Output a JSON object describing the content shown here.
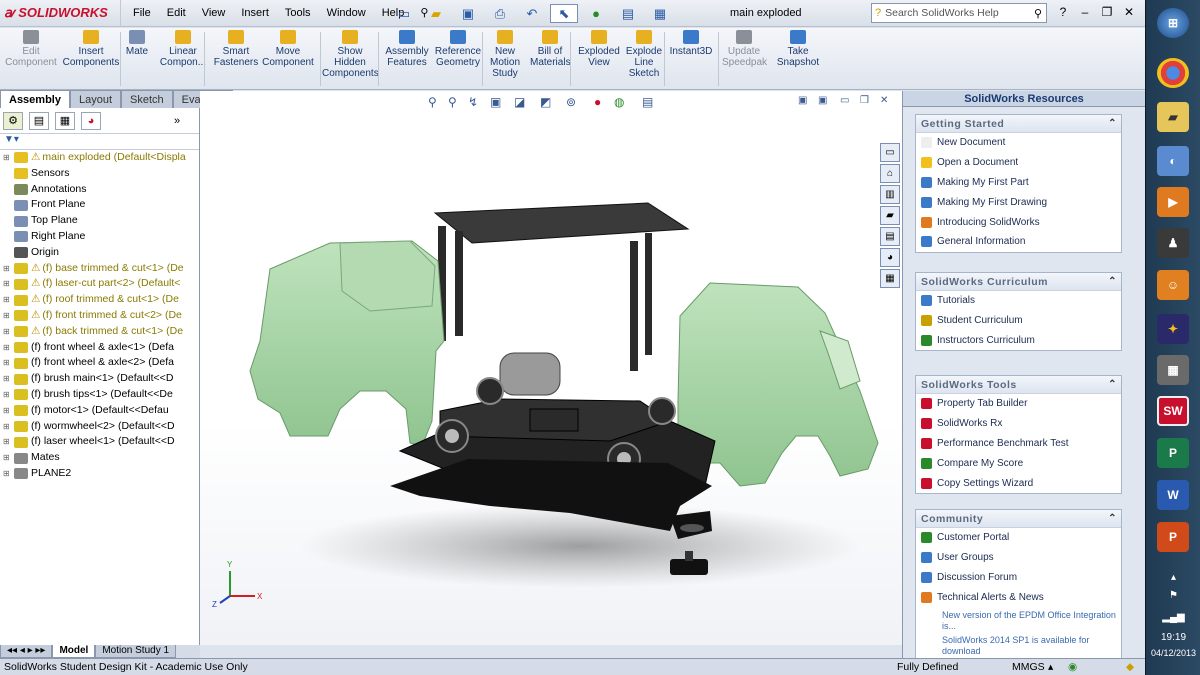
{
  "app": {
    "brand": "SOLIDWORKS",
    "doc_title": "main exploded"
  },
  "menu": [
    "File",
    "Edit",
    "View",
    "Insert",
    "Tools",
    "Window",
    "Help"
  ],
  "search": {
    "placeholder": "Search SolidWorks Help"
  },
  "commands": [
    {
      "label": "Edit Component",
      "disabled": true
    },
    {
      "label": "Insert Components"
    },
    {
      "label": "Mate"
    },
    {
      "label": "Linear Compon..."
    },
    {
      "label": "Smart Fasteners"
    },
    {
      "label": "Move Component"
    },
    {
      "label": "Show Hidden Components"
    },
    {
      "label": "Assembly Features"
    },
    {
      "label": "Reference Geometry"
    },
    {
      "label": "New Motion Study"
    },
    {
      "label": "Bill of Materials"
    },
    {
      "label": "Exploded View"
    },
    {
      "label": "Explode Line Sketch"
    },
    {
      "label": "Instant3D"
    },
    {
      "label": "Update Speedpak",
      "disabled": true
    },
    {
      "label": "Take Snapshot"
    }
  ],
  "tabs": [
    "Assembly",
    "Layout",
    "Sketch",
    "Evaluate"
  ],
  "tree": [
    {
      "label": "main exploded  (Default<Displa",
      "level": 0,
      "warn": true,
      "olive": true
    },
    {
      "label": "Sensors",
      "level": 1
    },
    {
      "label": "Annotations",
      "level": 1
    },
    {
      "label": "Front Plane",
      "level": 1
    },
    {
      "label": "Top Plane",
      "level": 1
    },
    {
      "label": "Right Plane",
      "level": 1
    },
    {
      "label": "Origin",
      "level": 1
    },
    {
      "label": "(f) base trimmed & cut<1> (De",
      "level": 1,
      "warn": true,
      "olive": true
    },
    {
      "label": "(f) laser-cut part<2> (Default<",
      "level": 1,
      "warn": true,
      "olive": true
    },
    {
      "label": "(f) roof trimmed & cut<1> (De",
      "level": 1,
      "warn": true,
      "olive": true
    },
    {
      "label": "(f) front trimmed & cut<2> (De",
      "level": 1,
      "warn": true,
      "olive": true
    },
    {
      "label": "(f) back trimmed & cut<1> (De",
      "level": 1,
      "warn": true,
      "olive": true
    },
    {
      "label": "(f) front wheel & axle<1> (Defa",
      "level": 1
    },
    {
      "label": "(f) front wheel & axle<2> (Defa",
      "level": 1
    },
    {
      "label": "(f) brush main<1> (Default<<D",
      "level": 1
    },
    {
      "label": "(f) brush tips<1> (Default<<De",
      "level": 1
    },
    {
      "label": "(f) motor<1> (Default<<Defau",
      "level": 1
    },
    {
      "label": "(f) wormwheel<2> (Default<<D",
      "level": 1
    },
    {
      "label": "(f) laser wheel<1> (Default<<D",
      "level": 1
    },
    {
      "label": "Mates",
      "level": 1
    },
    {
      "label": "PLANE2",
      "level": 1
    }
  ],
  "resources": {
    "title": "SolidWorks Resources",
    "sections": [
      {
        "title": "Getting Started",
        "items": [
          "New Document",
          "Open a Document",
          "Making My First Part",
          "Making My First Drawing",
          "Introducing SolidWorks",
          "General Information"
        ]
      },
      {
        "title": "SolidWorks Curriculum",
        "items": [
          "Tutorials",
          "Student Curriculum",
          "Instructors Curriculum"
        ]
      },
      {
        "title": "SolidWorks Tools",
        "items": [
          "Property Tab Builder",
          "SolidWorks Rx",
          "Performance Benchmark Test",
          "Compare My Score",
          "Copy Settings Wizard"
        ]
      },
      {
        "title": "Community",
        "items": [
          "Customer Portal",
          "User Groups",
          "Discussion Forum",
          "Technical Alerts & News"
        ],
        "news": [
          "New version of the EPDM Office Integration is...",
          "SolidWorks 2014 SP1 is available for download"
        ]
      }
    ]
  },
  "bottom_tabs": [
    "Model",
    "Motion Study 1"
  ],
  "status": {
    "left": "SolidWorks Student Design Kit - Academic Use Only",
    "state": "Fully Defined",
    "units": "MMGS"
  },
  "clock": {
    "time": "19:19",
    "date": "04/12/2013"
  },
  "colors": {
    "body": "#a8d8a8",
    "dark": "#1a1a1a",
    "accent": "#c8102e"
  }
}
